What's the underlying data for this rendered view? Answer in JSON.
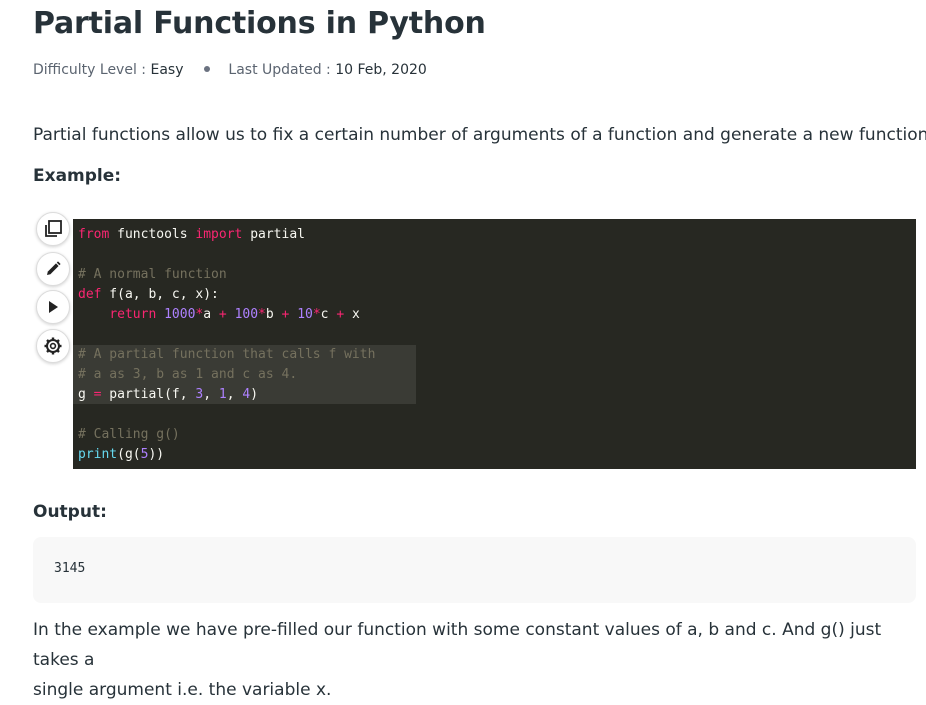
{
  "article": {
    "title": "Partial Functions in Python",
    "difficulty_label": "Difficulty Level : ",
    "difficulty_value": "Easy",
    "updated_label": "Last Updated : ",
    "updated_value": "10 Feb, 2020",
    "intro": "Partial functions allow us to fix a certain number of arguments of a function and generate a new function.",
    "example_heading": "Example:",
    "output_heading": "Output:",
    "output_value": "3145",
    "explanation_line1": "In the example we have pre-filled our function with some constant values of a, b and c. And g() just takes a",
    "explanation_line2": "single argument i.e. the variable x."
  },
  "toolbar": {
    "icons": [
      "copy-icon",
      "edit-icon",
      "run-icon",
      "settings-icon"
    ]
  },
  "code": {
    "language": "python",
    "t": {
      "from": "from",
      "functools": " functools ",
      "import": "import",
      "partial_name": " partial",
      "c1": "# A normal function",
      "def": "def",
      "sig": " f(a, b, c, x):",
      "indent": "    ",
      "return": "return",
      "sp": " ",
      "n1000": "1000",
      "star": "*",
      "a_": "a ",
      "plus": "+",
      "n100": "100",
      "b_": "b ",
      "n10": "10",
      "c_": "c ",
      "x": " x",
      "c2": "# A partial function that calls f with",
      "c3": "# a as 3, b as 1 and c as 4.",
      "g_": "g ",
      "eq": "=",
      "pcall": " partial(f, ",
      "n3": "3",
      "comma": ", ",
      "n1": "1",
      "n4": "4",
      "close": ")",
      "c4": "# Calling g()",
      "print": "print",
      "gopen": "(g(",
      "n5": "5",
      "close2": "))"
    }
  },
  "colors": {
    "code_bg": "#272822",
    "keyword": "#f92672",
    "comment": "#75715e",
    "number": "#ae81ff",
    "builtin": "#66d9ef",
    "highlight_bg": "#3a3b35",
    "output_bg": "#f8f8f8"
  }
}
